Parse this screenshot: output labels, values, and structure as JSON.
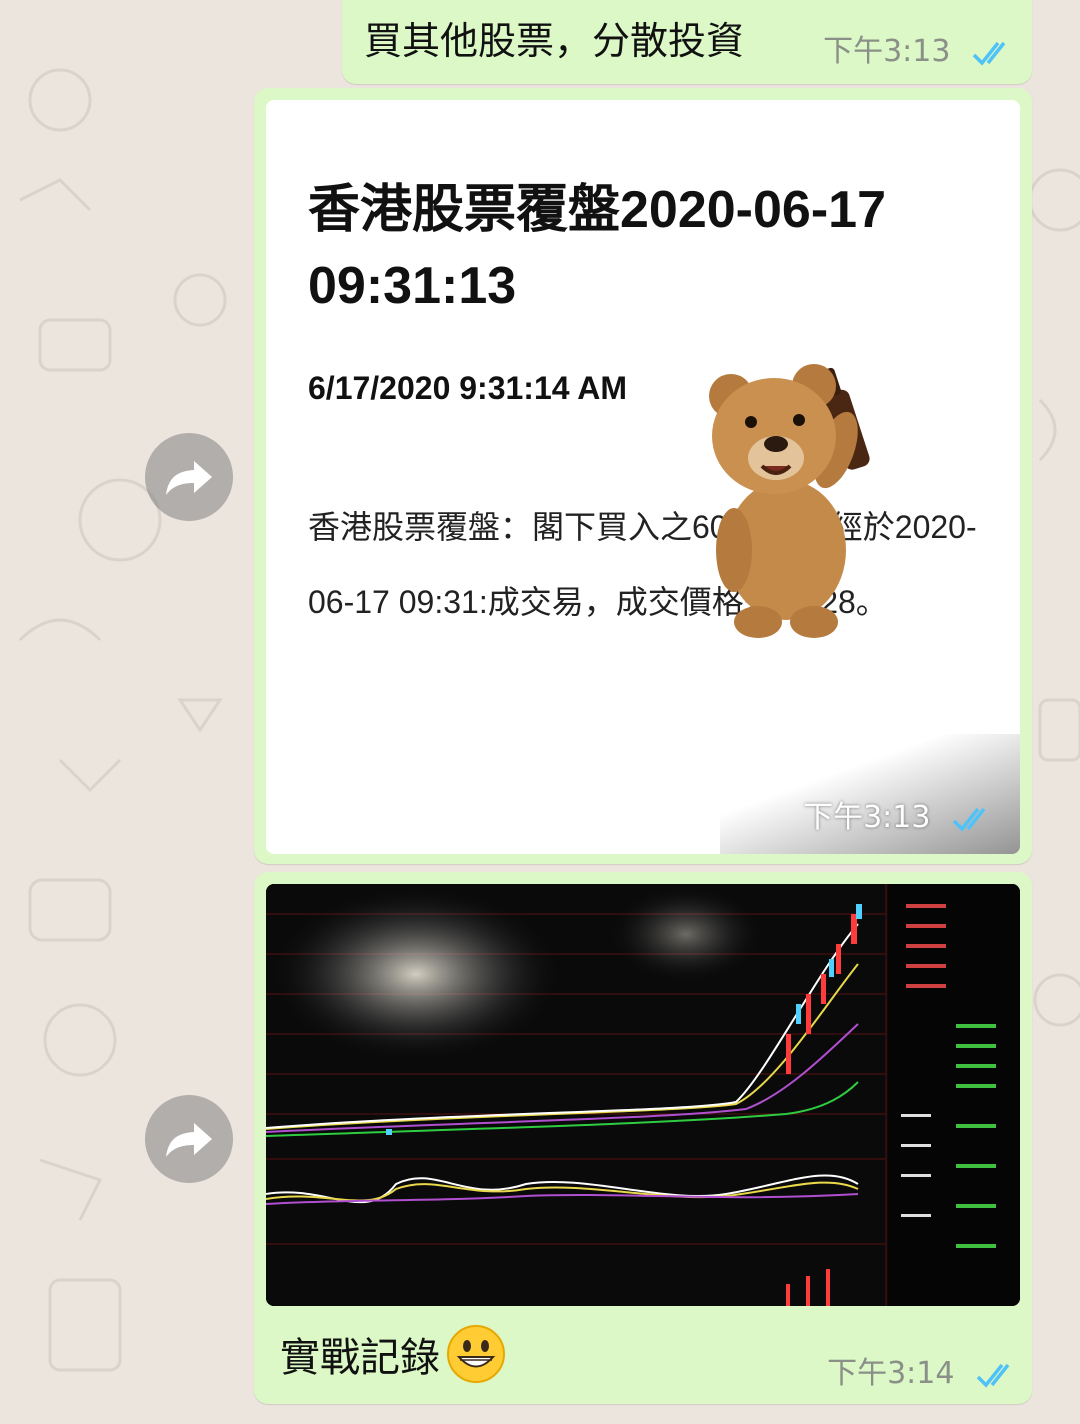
{
  "messages": {
    "sent_text": {
      "text": "買其他股票，分散投資",
      "time": "下午3:13"
    },
    "forwarded_card": {
      "title": "香港股票覆盤2020-06-17 09:31:13",
      "date": "6/17/2020 9:31:14 AM",
      "body": "香港股票覆盤：閣下買入之600685已經於2020-06-17 09:31:成交易，成交價格是17.28。",
      "time": "下午3:13"
    },
    "photo_message": {
      "caption": "實戰記錄",
      "time": "下午3:14"
    }
  },
  "icons": {
    "forward": "forward-arrow-icon",
    "read_receipt": "double-check-icon",
    "emoji": "grinning-face-icon"
  },
  "colors": {
    "bubble": "#DCF8C6",
    "background": "#ECE5DD",
    "read_tick": "#4FC3F7"
  }
}
